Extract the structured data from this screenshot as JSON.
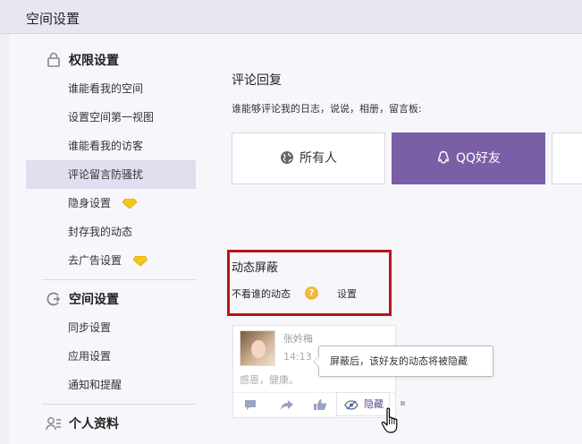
{
  "header": {
    "title": "空间设置"
  },
  "sidebar": {
    "sections": [
      {
        "label": "权限设置",
        "icon": "lock-icon"
      },
      {
        "label": "空间设置",
        "icon": "space-settings-icon"
      },
      {
        "label": "个人资料",
        "icon": "profile-icon"
      }
    ],
    "permission_items": [
      {
        "label": "谁能看我的空间"
      },
      {
        "label": "设置空间第一视图"
      },
      {
        "label": "谁能看我的访客"
      },
      {
        "label": "评论留言防骚扰"
      },
      {
        "label": "隐身设置",
        "badge": "diamond-icon"
      },
      {
        "label": "封存我的动态"
      },
      {
        "label": "去广告设置",
        "badge": "diamond-icon"
      }
    ],
    "space_items": [
      {
        "label": "同步设置"
      },
      {
        "label": "应用设置"
      },
      {
        "label": "通知和提醒"
      }
    ],
    "active_item": "评论留言防骚扰"
  },
  "main": {
    "section_title": "评论回复",
    "description": "谁能够评论我的日志，说说，相册，留言板:",
    "options": [
      {
        "label": "所有人",
        "icon": "globe-icon",
        "selected": false
      },
      {
        "label": "QQ好友",
        "icon": "qq-penguin-icon",
        "selected": true
      }
    ],
    "dynamic_block": {
      "title": "动态屏蔽",
      "row_label": "不看谁的动态",
      "help_icon_text": "?",
      "setting_label": "设置"
    },
    "feed_card": {
      "name": "张妗梅",
      "time": "14:13",
      "text": "感恩，健康。",
      "hide_label": "隐藏"
    },
    "tooltip": "屏蔽后，该好友的动态将被隐藏"
  },
  "colors": {
    "accent": "#7a5fa6",
    "highlight_box": "#b8141c",
    "help_icon": "#f3b73a",
    "diamond": "#f5c518"
  }
}
